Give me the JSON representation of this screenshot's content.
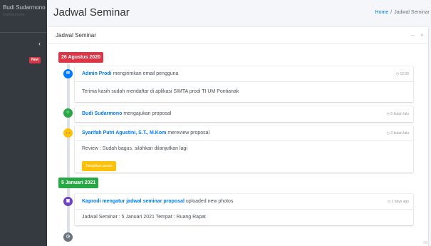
{
  "sidebar": {
    "user_name": "Budi Sudarmono",
    "user_role": "Mahasiswa",
    "toggle_icon": "chevron-left",
    "badge": "New"
  },
  "header": {
    "title": "Jadwal Seminar",
    "breadcrumb": {
      "home": "Home",
      "separator": "/",
      "current": "Jadwal Seminar"
    }
  },
  "card": {
    "title": "Jadwal Seminar",
    "tools": {
      "minimize": "–",
      "close": "×"
    }
  },
  "timeline": {
    "dates": [
      "26 Agustus 2020",
      "5 Januari 2021"
    ],
    "items": [
      {
        "icon": "envelope-icon",
        "icon_glyph": "✉",
        "color": "#007bff",
        "actor": "Admin Prodi",
        "action": "mengirimkan email pengguna",
        "time": "12:05",
        "body": "Terima kasih sudah mendaftar di aplikasi SIMTA prodi TI UM Pontianak"
      },
      {
        "icon": "user-icon",
        "icon_glyph": "☺",
        "color": "#28a745",
        "actor": "Budi Sudarmono",
        "action": "mengajukan proposal",
        "time": "5 bulan lalu"
      },
      {
        "icon": "comments-icon",
        "icon_glyph": "…",
        "color": "#ffc107",
        "actor": "Syarifah Putri Agustini, S.T., M.Kom",
        "action": "mereview proposal",
        "time": "3 bulan lalu",
        "body": "Review : Sudah bagus, silahkan dilanjutkan lagi",
        "button": "Tampilkan posan"
      },
      {
        "icon": "camera-icon",
        "icon_glyph": "▣",
        "color": "#6f42c1",
        "actor": "Kaprodi mengatur jadwal seminar proposal",
        "action": "uploaded new photos",
        "time": "2 days ago",
        "body": "Jadwal Seminar : 5 Januari 2021 Tempat : Ruang Rapat"
      }
    ],
    "end_icon": {
      "icon": "clock-icon",
      "icon_glyph": "◷",
      "color": "#6c757d"
    }
  }
}
